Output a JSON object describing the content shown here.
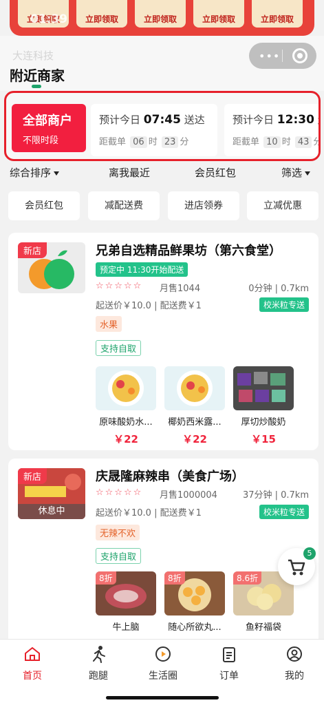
{
  "status": {
    "time": "01:39"
  },
  "coupons": {
    "claim_label": "立即领取"
  },
  "header": {
    "company": "大连科技",
    "title": "附近商家"
  },
  "time_slots": {
    "all": {
      "title": "全部商户",
      "subtitle": "不限时段"
    },
    "slots": [
      {
        "prefix": "预计今日",
        "time": "07:45",
        "suffix": "送达",
        "cutoff_prefix": "距截单",
        "hours": "06",
        "hour_unit": "时",
        "minutes": "23",
        "minute_unit": "分"
      },
      {
        "prefix": "预计今日",
        "time": "12:30",
        "suffix": "送达",
        "cutoff_prefix": "距截单",
        "hours": "10",
        "hour_unit": "时",
        "minutes": "43",
        "minute_unit": "分"
      }
    ]
  },
  "sort": {
    "comprehensive": "综合排序",
    "nearest": "离我最近",
    "member_red": "会员红包",
    "filter": "筛选"
  },
  "chips": [
    "会员红包",
    "减配送费",
    "进店领券",
    "立减优惠"
  ],
  "stores": [
    {
      "new_label": "新店",
      "name": "兄弟自选精品鲜果坊（第六食堂）",
      "preorder": "预定中 11:30开始配送",
      "stars": "☆☆☆☆☆",
      "monthly_sales": "月售1044",
      "distance": "0分钟 | 0.7km",
      "fees": "起送价￥10.0 | 配送费￥1",
      "delivery": "校米粒专送",
      "category": "水果",
      "pickup": "支持自取",
      "products": [
        {
          "name": "原味酸奶水...",
          "price": "￥22"
        },
        {
          "name": "椰奶西米露...",
          "price": "￥22"
        },
        {
          "name": "厚切炒酸奶",
          "price": "￥15"
        }
      ]
    },
    {
      "new_label": "新店",
      "resting": "休息中",
      "name": "庆晟隆麻辣串（美食广场）",
      "stars": "☆☆☆☆☆",
      "monthly_sales": "月售1000004",
      "distance": "37分钟 | 0.7km",
      "fees": "起送价￥10.0 | 配送费￥1",
      "delivery": "校米粒专送",
      "category": "无辣不欢",
      "pickup": "支持自取",
      "products": [
        {
          "discount": "8折",
          "name": "牛上脑"
        },
        {
          "discount": "8折",
          "name": "随心所欲丸..."
        },
        {
          "discount": "8.6折",
          "name": "鱼籽福袋"
        }
      ]
    }
  ],
  "cart": {
    "count": "5"
  },
  "tabs": [
    {
      "label": "首页",
      "icon": "home-icon"
    },
    {
      "label": "跑腿",
      "icon": "runner-icon"
    },
    {
      "label": "生活圈",
      "icon": "play-circle-icon"
    },
    {
      "label": "订单",
      "icon": "clipboard-icon"
    },
    {
      "label": "我的",
      "icon": "user-icon"
    }
  ],
  "colors": {
    "accent": "#e6202a",
    "green": "#1ea36b",
    "price": "#f0243c"
  }
}
